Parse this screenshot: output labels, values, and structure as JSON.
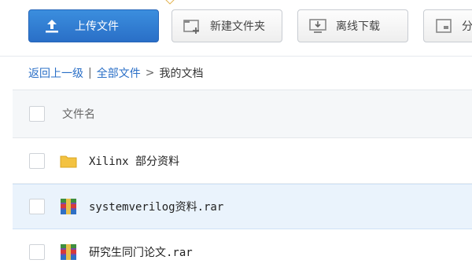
{
  "toolbar": {
    "upload_label": "上传文件",
    "new_folder_label": "新建文件夹",
    "offline_download_label": "离线下载",
    "more_label": "分",
    "upload_icon": "upload-icon",
    "new_folder_icon": "new-folder-icon",
    "offline_download_icon": "offline-download-icon",
    "more_icon": "share-icon"
  },
  "breadcrumb": {
    "back": "返回上一级",
    "separator": "|",
    "all_files": "全部文件",
    "arrow": ">",
    "current": "我的文档"
  },
  "list": {
    "header_label": "文件名",
    "rows": [
      {
        "name": "Xilinx 部分资料",
        "icon": "folder-icon",
        "selected": false
      },
      {
        "name": "systemverilog资料.rar",
        "icon": "rar-archive-icon",
        "selected": true
      },
      {
        "name": "研究生同门论文.rar",
        "icon": "rar-archive-icon",
        "selected": false
      }
    ]
  },
  "colors": {
    "accent": "#2a6fc7",
    "folder": "#f3c241",
    "selected_row": "#eaf3fc"
  }
}
